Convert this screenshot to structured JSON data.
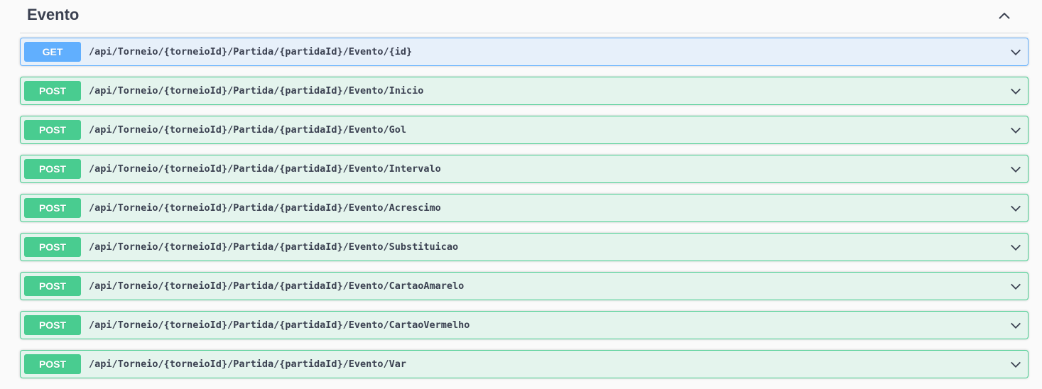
{
  "section": {
    "title": "Evento",
    "collapse_icon": "chevron-up-icon"
  },
  "operations": [
    {
      "method": "GET",
      "path": "/api/Torneio/{torneioId}/Partida/{partidaId}/Evento/{id}"
    },
    {
      "method": "POST",
      "path": "/api/Torneio/{torneioId}/Partida/{partidaId}/Evento/Inicio"
    },
    {
      "method": "POST",
      "path": "/api/Torneio/{torneioId}/Partida/{partidaId}/Evento/Gol"
    },
    {
      "method": "POST",
      "path": "/api/Torneio/{torneioId}/Partida/{partidaId}/Evento/Intervalo"
    },
    {
      "method": "POST",
      "path": "/api/Torneio/{torneioId}/Partida/{partidaId}/Evento/Acrescimo"
    },
    {
      "method": "POST",
      "path": "/api/Torneio/{torneioId}/Partida/{partidaId}/Evento/Substituicao"
    },
    {
      "method": "POST",
      "path": "/api/Torneio/{torneioId}/Partida/{partidaId}/Evento/CartaoAmarelo"
    },
    {
      "method": "POST",
      "path": "/api/Torneio/{torneioId}/Partida/{partidaId}/Evento/CartaoVermelho"
    },
    {
      "method": "POST",
      "path": "/api/Torneio/{torneioId}/Partida/{partidaId}/Evento/Var"
    }
  ],
  "colors": {
    "get": "#61affe",
    "post": "#49cc90",
    "text": "#3b4151"
  },
  "icons": {
    "expand": "chevron-down-icon"
  }
}
